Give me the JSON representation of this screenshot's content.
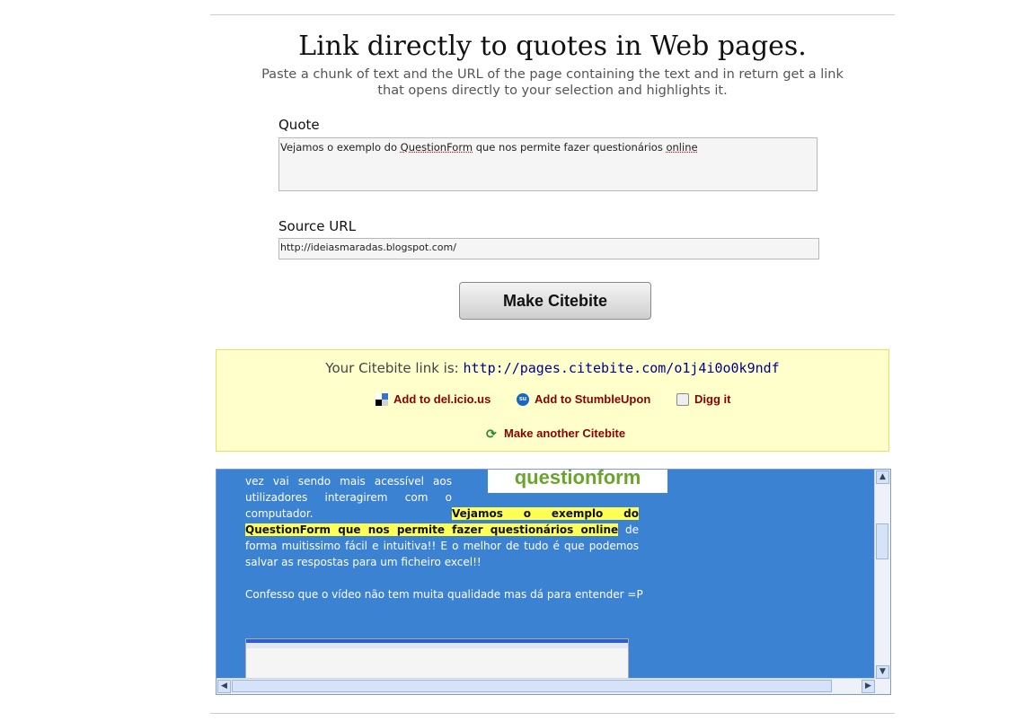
{
  "header": {
    "title": "Link directly to quotes in Web pages.",
    "subtitle": "Paste a chunk of text and the URL of the page containing the text and in return get a link that opens directly to your selection and highlights it."
  },
  "form": {
    "quote_label": "Quote",
    "quote_value_parts": [
      "Vejamos o exemplo do ",
      "QuestionForm",
      " que nos permite fazer questionários ",
      "online"
    ],
    "url_label": "Source URL",
    "url_value": "http://ideiasmaradas.blogspot.com/",
    "submit_label": "Make Citebite"
  },
  "result": {
    "prefix": "Your Citebite link is:",
    "link": "http://pages.citebite.com/o1j4i0o0k9ndf",
    "share": {
      "delicious": "Add to del.icio.us",
      "stumble": "Add to StumbleUpon",
      "digg": "Digg it",
      "another": "Make another Citebite"
    }
  },
  "preview": {
    "logo": "questionform",
    "text_before": "vez vai sendo mais acessível aos utilizadores interagirem com o computador. ",
    "highlight": "Vejamos o exemplo do QuestionForm que nos permite fazer questionários online",
    "text_after": " de forma muitissimo fácil e intuitiva!! E o melhor de tudo é que podemos salvar as respostas para um ficheiro excel!!",
    "paragraph2": "Confesso que o vídeo não tem muita qualidade mas dá para entender =P"
  },
  "icons": {
    "delicious": "delicious-icon",
    "stumble": "stumbleupon-icon",
    "digg": "digg-icon",
    "refresh": "refresh-icon"
  }
}
